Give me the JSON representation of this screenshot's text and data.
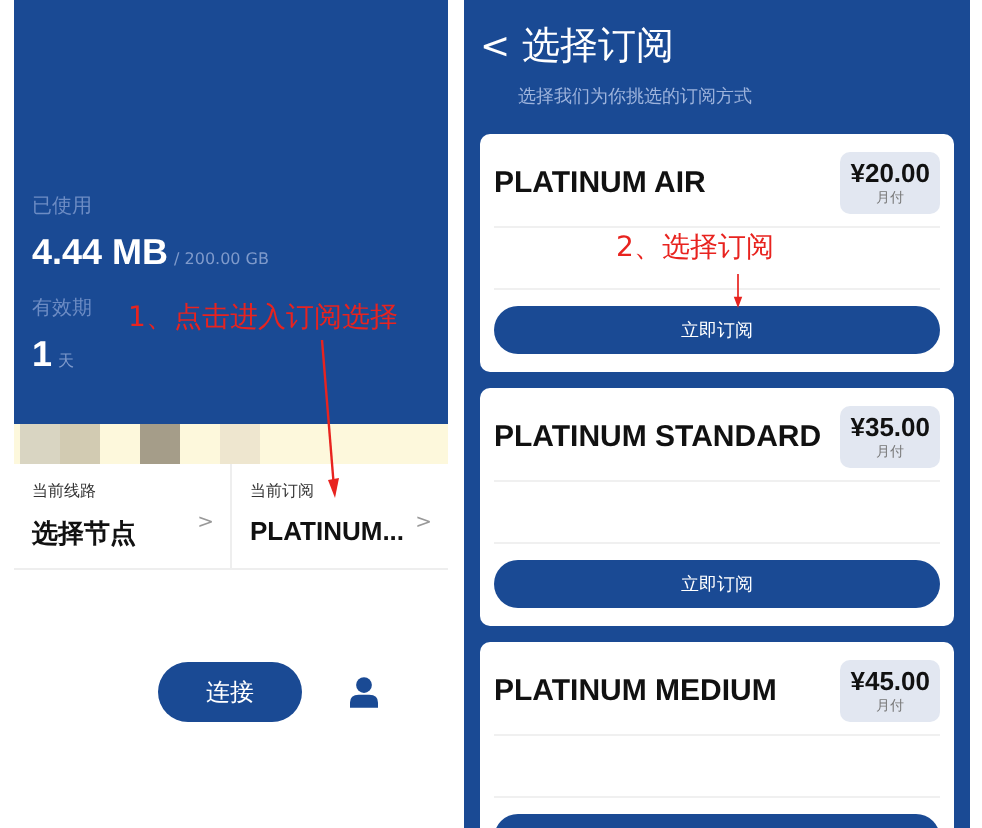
{
  "home": {
    "used_label": "已使用",
    "used_value": "4.44 MB",
    "used_total": "/ 200.00 GB",
    "validity_label": "有效期",
    "validity_value": "1",
    "validity_unit": "天",
    "info": [
      {
        "label": "当前线路",
        "value": "选择节点",
        "chevron": ">"
      },
      {
        "label": "当前订阅",
        "value": "PLATINUM...",
        "chevron": ">"
      }
    ],
    "connect_button": "连接"
  },
  "subscribe": {
    "back": "<",
    "title": "选择订阅",
    "subtitle": "选择我们为你挑选的订阅方式",
    "plans": [
      {
        "name": "PLATINUM AIR",
        "price": "¥20.00",
        "period": "月付",
        "button": "立即订阅"
      },
      {
        "name": "PLATINUM STANDARD",
        "price": "¥35.00",
        "period": "月付",
        "button": "立即订阅"
      },
      {
        "name": "PLATINUM MEDIUM",
        "price": "¥45.00",
        "period": "月付"
      }
    ]
  },
  "annotations": [
    "1、点击进入订阅选择",
    "2、选择订阅"
  ]
}
